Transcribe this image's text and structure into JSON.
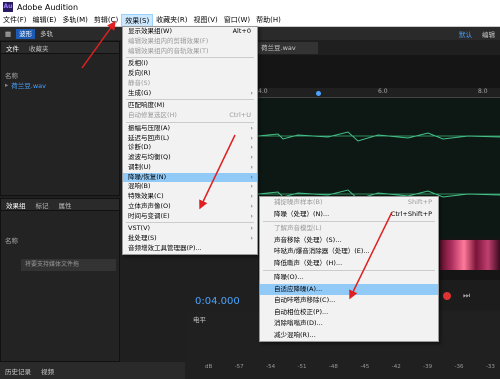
{
  "title_bar": {
    "icon": "Au",
    "title": "Adobe Audition"
  },
  "menu": [
    {
      "label": "文件(F)"
    },
    {
      "label": "编辑(E)"
    },
    {
      "label": "多轨(M)"
    },
    {
      "label": "剪辑(C)"
    },
    {
      "label": "效果(S)",
      "active": true
    },
    {
      "label": "收藏夹(R)"
    },
    {
      "label": "视图(V)"
    },
    {
      "label": "窗口(W)"
    },
    {
      "label": "帮助(H)"
    }
  ],
  "toolbar": {
    "waveform": "波形",
    "multitrack": "多轨",
    "workspace": "默认",
    "edit": "编辑"
  },
  "files_panel": {
    "tab_files": "文件",
    "tab_favorites": "收藏夹",
    "col_name": "名称",
    "file_name": "荷兰豆.wav"
  },
  "effects_panel": {
    "tab_rack": "效果组",
    "tab_markers": "标记",
    "tab_props": "属性",
    "col_name": "名称",
    "hint": "将要支持媒体文件拖"
  },
  "editor": {
    "tab_label": "荷兰豆.wav",
    "ruler_labels": [
      "4.0",
      "6.0",
      "8.0"
    ]
  },
  "timecode": "0:04.000",
  "level_label": "电平",
  "status_bar": {
    "history": "历史记录",
    "video": "视频"
  },
  "effects_menu": [
    {
      "label": "显示效果组(W)",
      "shortcut": "Alt+0"
    },
    {
      "label": "编辑效果组内的剪辑效果(F)",
      "disabled": true
    },
    {
      "label": "编辑效果组内的音轨效果(T)",
      "disabled": true
    },
    {
      "sep": true
    },
    {
      "label": "反相(I)"
    },
    {
      "label": "反向(R)"
    },
    {
      "label": "静音(S)",
      "disabled": true
    },
    {
      "label": "生成(G)",
      "submenu": true
    },
    {
      "sep": true
    },
    {
      "label": "匹配响度(M)"
    },
    {
      "label": "自动修复选区(H)",
      "shortcut": "Ctrl+U",
      "disabled": true
    },
    {
      "sep": true
    },
    {
      "label": "振幅与压限(A)",
      "submenu": true
    },
    {
      "label": "延迟与回声(L)",
      "submenu": true
    },
    {
      "label": "诊断(D)",
      "submenu": true
    },
    {
      "label": "滤波与均衡(Q)",
      "submenu": true
    },
    {
      "label": "调制(U)",
      "submenu": true
    },
    {
      "label": "降噪/恢复(N)",
      "submenu": true,
      "hover": true
    },
    {
      "label": "混响(B)",
      "submenu": true
    },
    {
      "label": "特殊效果(C)",
      "submenu": true
    },
    {
      "label": "立体声声像(O)",
      "submenu": true
    },
    {
      "label": "时间与变调(E)",
      "submenu": true
    },
    {
      "sep": true
    },
    {
      "label": "VST(V)",
      "submenu": true
    },
    {
      "label": "批处理(S)",
      "submenu": true
    },
    {
      "label": "音频增效工具管理器(P)..."
    }
  ],
  "noise_submenu": [
    {
      "label": "捕捉噪声样本(B)",
      "shortcut": "Shift+P",
      "disabled": true
    },
    {
      "label": "降噪（处理）(N)...",
      "shortcut": "Ctrl+Shift+P"
    },
    {
      "sep": true
    },
    {
      "label": "了解声音模型(L)",
      "disabled": true
    },
    {
      "label": "声音移除（处理）(S)..."
    },
    {
      "label": "咔哒声/爆音消除器（处理）(E)..."
    },
    {
      "label": "降低嘶声（处理）(H)..."
    },
    {
      "sep": true
    },
    {
      "label": "降噪(O)..."
    },
    {
      "label": "自适应降噪(A)...",
      "hover": true
    },
    {
      "label": "自动咔嗒声移除(C)..."
    },
    {
      "label": "自动相位校正(P)..."
    },
    {
      "label": "消除嗡嗡声(D)..."
    },
    {
      "label": "减少混响(R)..."
    }
  ],
  "level_ticks": [
    "dB",
    "-57",
    "-54",
    "-51",
    "-48",
    "-45",
    "-42",
    "-39",
    "-36",
    "-33"
  ]
}
